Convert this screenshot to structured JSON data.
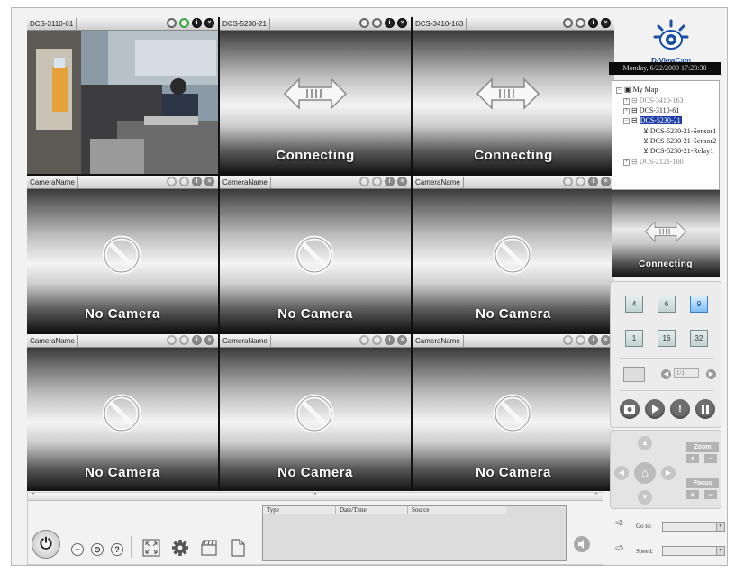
{
  "app": {
    "brand_prefix": "D-View",
    "brand_suffix": "Cam",
    "datetime": "Monday, 6/22/2009 17:23:30"
  },
  "cameras": [
    {
      "name": "DCS-3110-61",
      "status": ""
    },
    {
      "name": "DCS-5230-21",
      "status": "Connecting"
    },
    {
      "name": "DCS-3410-163",
      "status": "Connecting"
    },
    {
      "name": "CameraName",
      "status": "No Camera"
    },
    {
      "name": "CameraName",
      "status": "No Camera"
    },
    {
      "name": "CameraName",
      "status": "No Camera"
    },
    {
      "name": "CameraName",
      "status": "No Camera"
    },
    {
      "name": "CameraName",
      "status": "No Camera"
    },
    {
      "name": "CameraName",
      "status": "No Camera"
    }
  ],
  "tree": {
    "root": "My Map",
    "items": [
      {
        "label": "DCS-3410-163"
      },
      {
        "label": "DCS-3110-61"
      },
      {
        "label": "DCS-5230-21"
      },
      {
        "label": "DCS-5230-21-Sensor1"
      },
      {
        "label": "DCS-5230-21-Sensor2"
      },
      {
        "label": "DCS-5230-21-Relay1"
      },
      {
        "label": "DCS-2121-100"
      }
    ]
  },
  "preview": {
    "status": "Connecting"
  },
  "layouts": {
    "b4": "4",
    "b6": "6",
    "b9": "9",
    "b1": "1",
    "b16": "16",
    "b32": "32"
  },
  "pager": {
    "value": "1/1"
  },
  "ptz": {
    "zoom_label": "Zoom",
    "focus_label": "Focus",
    "plus": "+",
    "minus": "−"
  },
  "goto": {
    "label": "Go to:"
  },
  "speed": {
    "label": "Speed:"
  },
  "events": {
    "col_type": "Type",
    "col_datetime": "Date/Time",
    "col_source": "Source"
  },
  "colors": {
    "selected_border": "#d9a520",
    "tree_highlight": "#1f3fa7",
    "active_layout": "#7fbdf5",
    "brand": "#123c8c"
  }
}
